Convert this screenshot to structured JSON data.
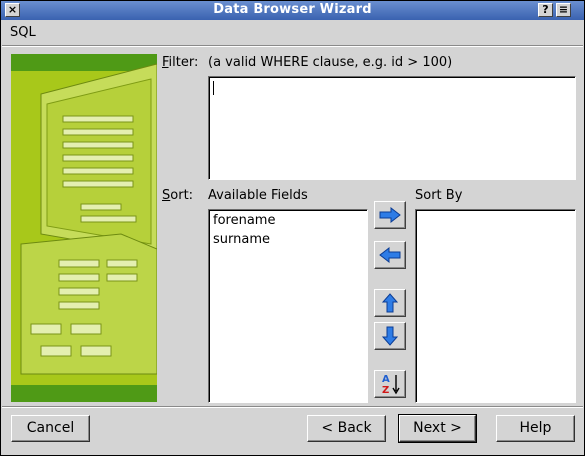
{
  "window": {
    "title": "Data Browser Wizard",
    "help_glyph": "?",
    "menu_glyph": "≡",
    "close_glyph": "×"
  },
  "section_label": "SQL",
  "filter": {
    "label_prefix": "F",
    "label_rest": "ilter:",
    "hint": "(a valid WHERE clause, e.g. id > 100)",
    "value": ""
  },
  "sort": {
    "label_prefix": "S",
    "label_rest": "ort:",
    "available_header": "Available Fields",
    "available_fields": [
      "forename",
      "surname"
    ],
    "sortby_header": "Sort By",
    "sortby_fields": []
  },
  "arrow_buttons": {
    "az_top": "A",
    "az_bottom": "Z"
  },
  "footer": {
    "cancel": "Cancel",
    "back": "< Back",
    "next": "Next >",
    "help": "Help"
  },
  "colors": {
    "accent": "#1f5fd0",
    "art_green": "#a8c81a",
    "art_dark": "#4f9a16"
  }
}
